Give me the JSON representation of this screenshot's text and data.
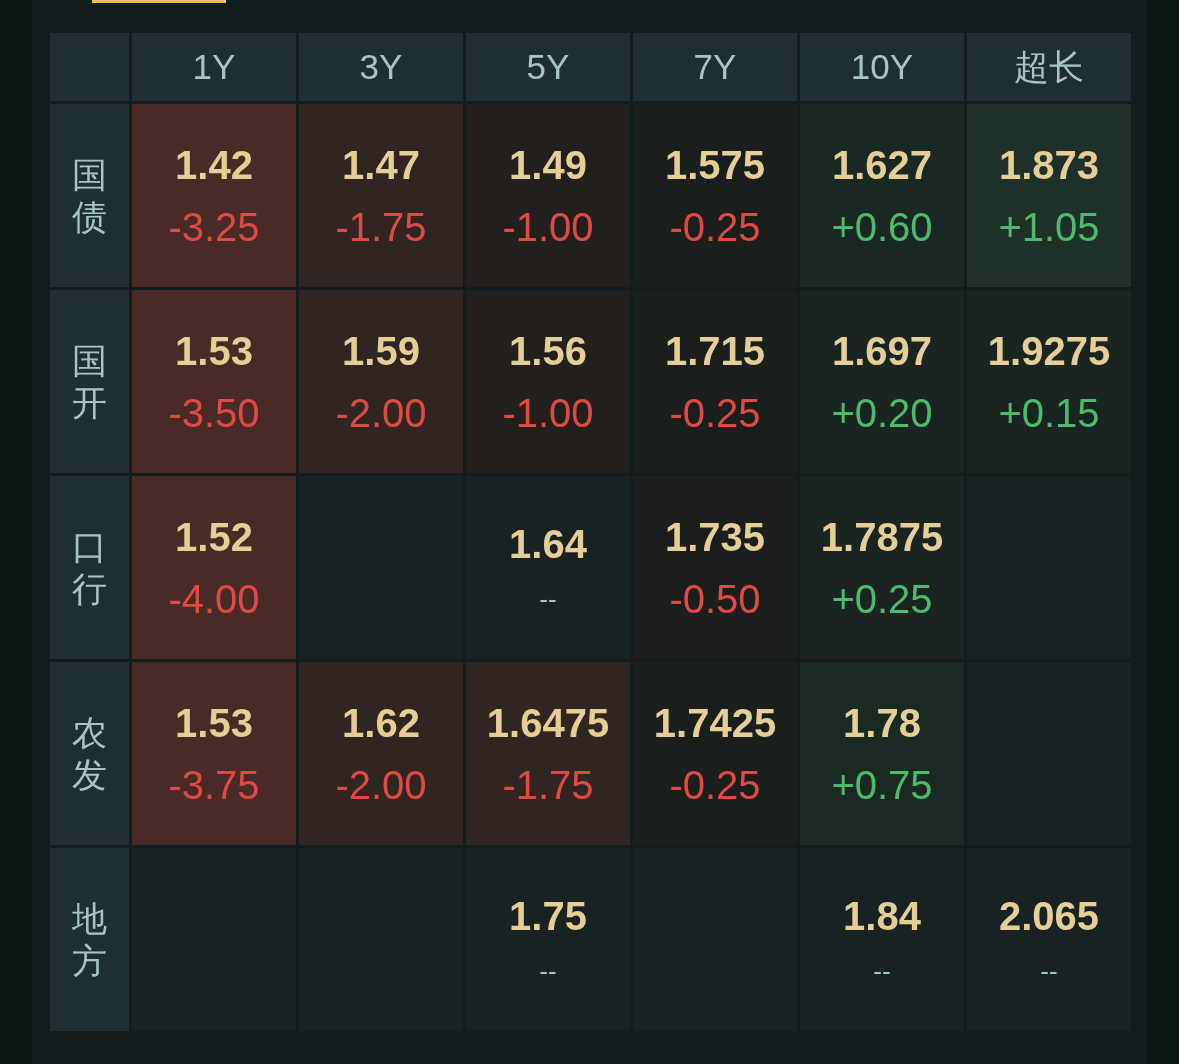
{
  "columns": [
    "1Y",
    "3Y",
    "5Y",
    "7Y",
    "10Y",
    "超长"
  ],
  "rows": [
    {
      "label": "国债",
      "cells": [
        {
          "kind": "fall",
          "value": "1.42",
          "change": "-3.25",
          "color": "#4a2a26"
        },
        {
          "kind": "fall",
          "value": "1.47",
          "change": "-1.75",
          "color": "#302521"
        },
        {
          "kind": "fall",
          "value": "1.49",
          "change": "-1.00",
          "color": "#221f1d"
        },
        {
          "kind": "fall",
          "value": "1.575",
          "change": "-0.25",
          "color": "#1a1e1d"
        },
        {
          "kind": "rise",
          "value": "1.627",
          "change": "+0.60",
          "color": "#1a2823"
        },
        {
          "kind": "rise",
          "value": "1.873",
          "change": "+1.05",
          "color": "#1e3028"
        }
      ]
    },
    {
      "label": "国开",
      "cells": [
        {
          "kind": "fall",
          "value": "1.53",
          "change": "-3.50",
          "color": "#4a2a26"
        },
        {
          "kind": "fall",
          "value": "1.59",
          "change": "-2.00",
          "color": "#302521"
        },
        {
          "kind": "fall",
          "value": "1.56",
          "change": "-1.00",
          "color": "#221f1d"
        },
        {
          "kind": "fall",
          "value": "1.715",
          "change": "-0.25",
          "color": "#1a1e1d"
        },
        {
          "kind": "rise",
          "value": "1.697",
          "change": "+0.20",
          "color": "#1a2420"
        },
        {
          "kind": "rise",
          "value": "1.9275",
          "change": "+0.15",
          "color": "#1a2420"
        }
      ]
    },
    {
      "label": "口行",
      "cells": [
        {
          "kind": "fall",
          "value": "1.52",
          "change": "-4.00",
          "color": "#4a2a26"
        },
        {
          "kind": "empty",
          "color": "#182222"
        },
        {
          "kind": "flat",
          "value": "1.64",
          "change": "--",
          "color": "#182222"
        },
        {
          "kind": "fall",
          "value": "1.735",
          "change": "-0.50",
          "color": "#1c1e1d"
        },
        {
          "kind": "rise",
          "value": "1.7875",
          "change": "+0.25",
          "color": "#1a2420"
        },
        {
          "kind": "empty",
          "color": "#182222"
        }
      ]
    },
    {
      "label": "农发",
      "cells": [
        {
          "kind": "fall",
          "value": "1.53",
          "change": "-3.75",
          "color": "#4a2a26"
        },
        {
          "kind": "fall",
          "value": "1.62",
          "change": "-2.00",
          "color": "#302521"
        },
        {
          "kind": "fall",
          "value": "1.6475",
          "change": "-1.75",
          "color": "#302521"
        },
        {
          "kind": "fall",
          "value": "1.7425",
          "change": "-0.25",
          "color": "#1a1e1d"
        },
        {
          "kind": "rise",
          "value": "1.78",
          "change": "+0.75",
          "color": "#1a2a22"
        },
        {
          "kind": "empty",
          "color": "#182222"
        }
      ]
    },
    {
      "label": "地方",
      "cells": [
        {
          "kind": "empty",
          "color": "#182222"
        },
        {
          "kind": "empty",
          "color": "#182222"
        },
        {
          "kind": "flat",
          "value": "1.75",
          "change": "--",
          "color": "#182222"
        },
        {
          "kind": "empty",
          "color": "#182222"
        },
        {
          "kind": "flat",
          "value": "1.84",
          "change": "--",
          "color": "#182222"
        },
        {
          "kind": "flat",
          "value": "2.065",
          "change": "--",
          "color": "#182222"
        }
      ]
    }
  ]
}
